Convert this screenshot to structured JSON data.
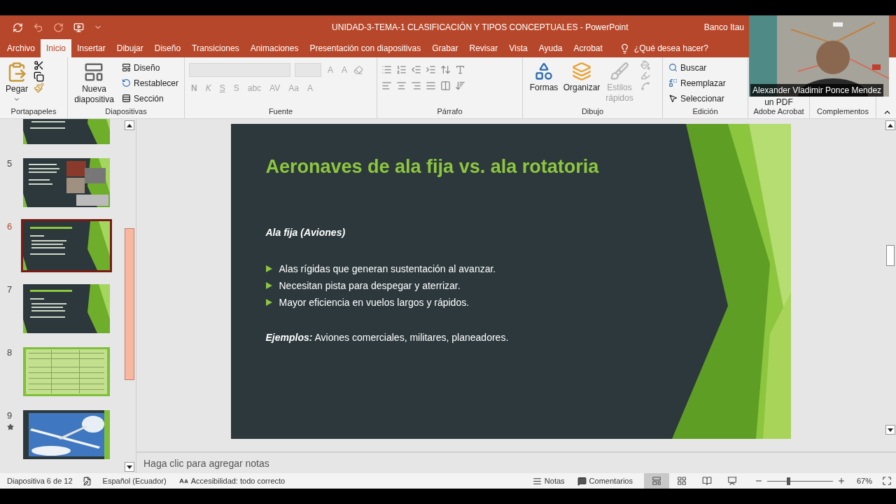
{
  "title_bar": {
    "title": "UNIDAD-3-TEMA-1 CLASIFICACIÓN Y TIPOS CONCEPTUALES  -  PowerPoint",
    "account": "Banco Itau"
  },
  "tabs": [
    {
      "label": "Archivo",
      "selected": false
    },
    {
      "label": "Inicio",
      "selected": true
    },
    {
      "label": "Insertar",
      "selected": false
    },
    {
      "label": "Dibujar",
      "selected": false
    },
    {
      "label": "Diseño",
      "selected": false
    },
    {
      "label": "Transiciones",
      "selected": false
    },
    {
      "label": "Animaciones",
      "selected": false
    },
    {
      "label": "Presentación con diapositivas",
      "selected": false
    },
    {
      "label": "Grabar",
      "selected": false
    },
    {
      "label": "Revisar",
      "selected": false
    },
    {
      "label": "Vista",
      "selected": false
    },
    {
      "label": "Ayuda",
      "selected": false
    },
    {
      "label": "Acrobat",
      "selected": false
    }
  ],
  "tell_me": "¿Qué desea hacer?",
  "ribbon_groups": [
    {
      "kind": "clipboard",
      "label": "Portapapeles",
      "paste": "Pegar"
    },
    {
      "kind": "slides",
      "label": "Diapositivas",
      "new_slide": "Nueva diapositiva",
      "items": [
        "Diseño",
        "Restablecer",
        "Sección"
      ]
    },
    {
      "kind": "font",
      "label": "Fuente",
      "disabled": true,
      "size_glyphs": [
        "A",
        "A"
      ],
      "glyphs": [
        "N",
        "K",
        "S",
        "S",
        "abc",
        "AV",
        "Aa",
        "A"
      ]
    },
    {
      "kind": "paragraph",
      "label": "Párrafo"
    },
    {
      "kind": "drawing",
      "label": "Dibujo",
      "buttons": [
        {
          "label": "Formas",
          "disabled": false
        },
        {
          "label": "Organizar",
          "disabled": false
        },
        {
          "label": "Estilos rápidos",
          "disabled": true
        }
      ]
    },
    {
      "kind": "editing",
      "label": "Edición",
      "items": [
        "Buscar",
        "Reemplazar",
        "Seleccionar"
      ]
    },
    {
      "kind": "acrobat",
      "label": "Adobe Acrobat",
      "text": "un PDF"
    },
    {
      "kind": "addins",
      "label": "Complementos"
    }
  ],
  "webcam": {
    "caption": "Alexander Vladimir Ponce Mendez"
  },
  "thumbnails": [
    {
      "kind": "text",
      "selected": false,
      "animated": false
    },
    {
      "number": "5",
      "kind": "photos",
      "selected": false,
      "animated": false
    },
    {
      "number": "6",
      "kind": "text",
      "selected": true,
      "animated": false
    },
    {
      "number": "7",
      "kind": "text",
      "selected": false,
      "animated": false
    },
    {
      "number": "8",
      "kind": "table",
      "selected": false,
      "animated": false
    },
    {
      "number": "9",
      "kind": "picture",
      "selected": false,
      "animated": true
    }
  ],
  "slide": {
    "title": "Aeronaves de ala fija vs. ala rotatoria",
    "subtitle": "Ala fija (Aviones)",
    "bullets": [
      "Alas rígidas que generan sustentación al avanzar.",
      "Necesitan pista para despegar y aterrizar.",
      "Mayor eficiencia en vuelos largos y rápidos."
    ],
    "examples": "**Ejemplos:** Aviones comerciales, militares, planeadores."
  },
  "notes_placeholder": "Haga clic para agregar notas",
  "status_bar": {
    "slide_count": "Diapositiva 6 de 12",
    "language": "Español (Ecuador)",
    "accessibility": "Accesibilidad: todo correcto",
    "notes": "Notas",
    "comments": "Comentarios",
    "views": [
      {
        "kind": "normal",
        "selected": true
      },
      {
        "kind": "sorter",
        "selected": false
      },
      {
        "kind": "reading",
        "selected": false
      },
      {
        "kind": "show",
        "selected": false
      }
    ],
    "zoom": {
      "level": 0.32,
      "reading": "67%"
    }
  }
}
